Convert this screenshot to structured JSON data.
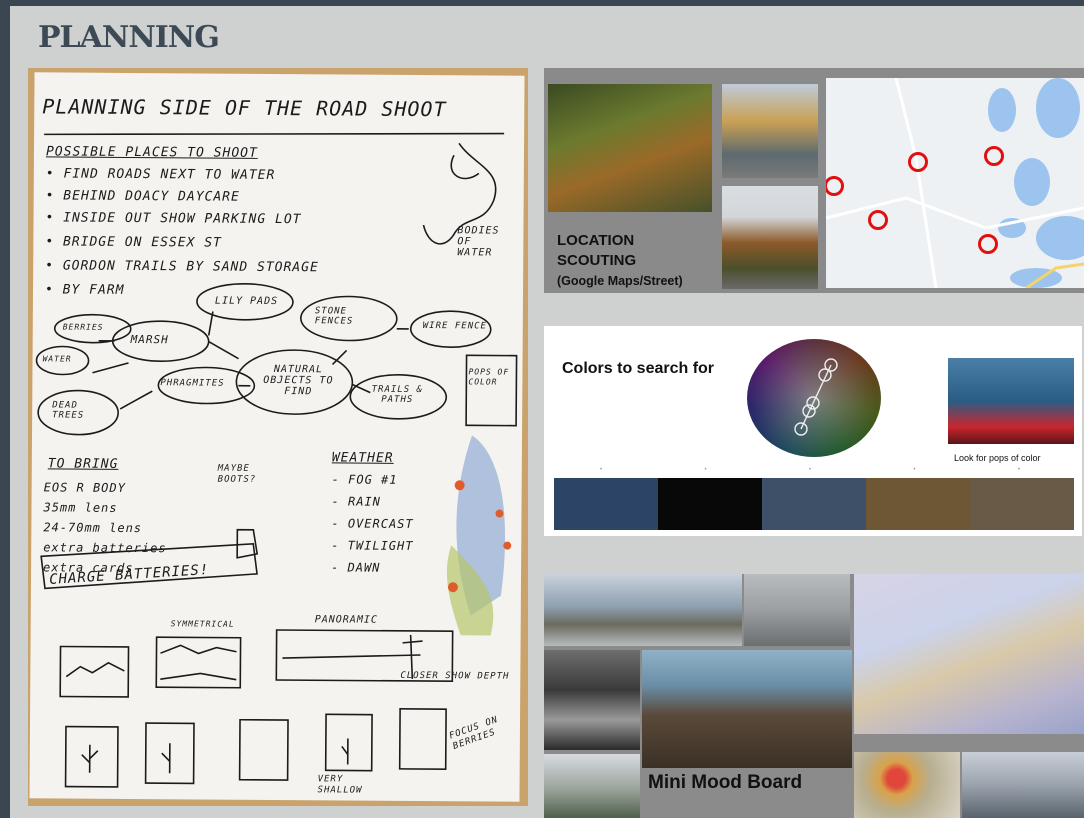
{
  "heading": "PLANNING",
  "notes": {
    "title": "PLANNING SIDE OF THE ROAD SHOOT",
    "places_heading": "POSSIBLE PLACES TO SHOOT",
    "places": [
      "• FIND ROADS NEXT TO WATER",
      "• BEHIND DOACY DAYCARE",
      "• INSIDE OUT SHOW PARKING LOT",
      "• BRIDGE ON ESSEX ST",
      "• GORDON TRAILS BY SAND STORAGE",
      "• BY FARM"
    ],
    "bodies_of_water": "BODIES OF WATER",
    "mindmap": {
      "center": "NATURAL OBJECTS TO FIND",
      "nodes": [
        "LILY PADS",
        "STONE FENCES",
        "WIRE FENCE",
        "MARSH",
        "BERRIES",
        "WATER",
        "PHRAGMITES",
        "DEAD TREES",
        "TRAILS & PATHS",
        "POPS OF COLOR"
      ]
    },
    "to_bring_heading": "TO BRING",
    "to_bring": [
      "EOS R BODY",
      "35mm lens",
      "24-70mm lens",
      "extra batteries",
      "extra cards"
    ],
    "maybe": "MAYBE BOOTS?",
    "weather_heading": "WEATHER",
    "weather": [
      "- FOG #1",
      "- RAIN",
      "- OVERCAST",
      "- TWILIGHT",
      "- DAWN"
    ],
    "charge": "CHARGE BATTERIES!",
    "symmetrical": "SYMMETRICAL",
    "panoramic": "PANORAMIC",
    "closer": "CLOSER SHOW DEPTH",
    "very_shallow": "VERY SHALLOW",
    "focus": "FOCUS ON BERRIES"
  },
  "location": {
    "label_line1": "LOCATION",
    "label_line2": "SCOUTING",
    "label_line3": "(Google Maps/Street)"
  },
  "colors": {
    "title": "Colors to search for",
    "caption": "Look for pops of color",
    "palette": [
      "#2c4566",
      "#080808",
      "#3e5068",
      "#6e5734",
      "#685a46"
    ]
  },
  "mood": {
    "label": "Mini Mood Board"
  }
}
